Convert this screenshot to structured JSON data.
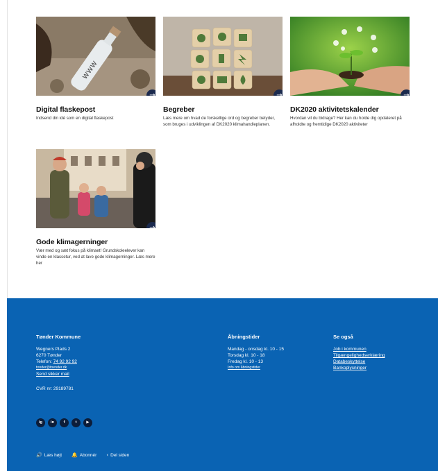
{
  "cards": [
    {
      "title": "Digital flaskepost",
      "text": "Indsend din idé som en digital flaskepost",
      "image_icon": "bottle-image"
    },
    {
      "title": "Begreber",
      "text": "Læs mere om hvad de forskellige ord og begreber betyder, som bruges i udviklingen af DK2020 klimahandleplanen.",
      "image_icon": "eco-blocks-image"
    },
    {
      "title": "DK2020 aktivitetskalender",
      "text": "Hvordan vil du bidrage? Her kan du holde dig opdateret på afholdte og fremtidige DK2020 aktiviteter",
      "image_icon": "hands-plant-image"
    },
    {
      "title": "Gode klimagerninger",
      "text": "Vær med og sæt fokus på klimaet! Grundskoleelever kan vinde en klassetur, ved at lave gode klimagerninger. Læs mere her",
      "image_icon": "cyclists-image"
    }
  ],
  "arrow_glyph": "→",
  "footer": {
    "org": {
      "title": "Tønder Kommune",
      "address1": "Wegners Plads 2",
      "address2": "6270 Tønder",
      "phone_label": "Telefon: ",
      "phone": "74 92 92 92",
      "email": "tonder@toender.dk",
      "secure_mail": "Send sikker mail",
      "cvr": "CVR nr: 29189781"
    },
    "hours": {
      "title": "Åbningstider",
      "line1": "Mandag - onsdag kl. 10 - 15",
      "line2": "Torsdag kl. 10 - 18",
      "line3": "Fredag kl. 10 - 13",
      "link": "Info om åbningstider"
    },
    "see_also": {
      "title": "Se også",
      "links": [
        "Job i kommunen",
        "Tilgængelighedserklæring",
        "Databeskyttelse",
        "Bankoplysninger"
      ]
    },
    "socials": [
      "ig",
      "in",
      "f",
      "t",
      "▶"
    ],
    "bottom": {
      "read_aloud": "Læs højt",
      "subscribe": "Abonnér",
      "share": "Del siden"
    }
  },
  "colors": {
    "footer_bg": "#0a63b3",
    "arrow_bg": "#1b2a4e",
    "social_bg": "#0c1d3a"
  }
}
